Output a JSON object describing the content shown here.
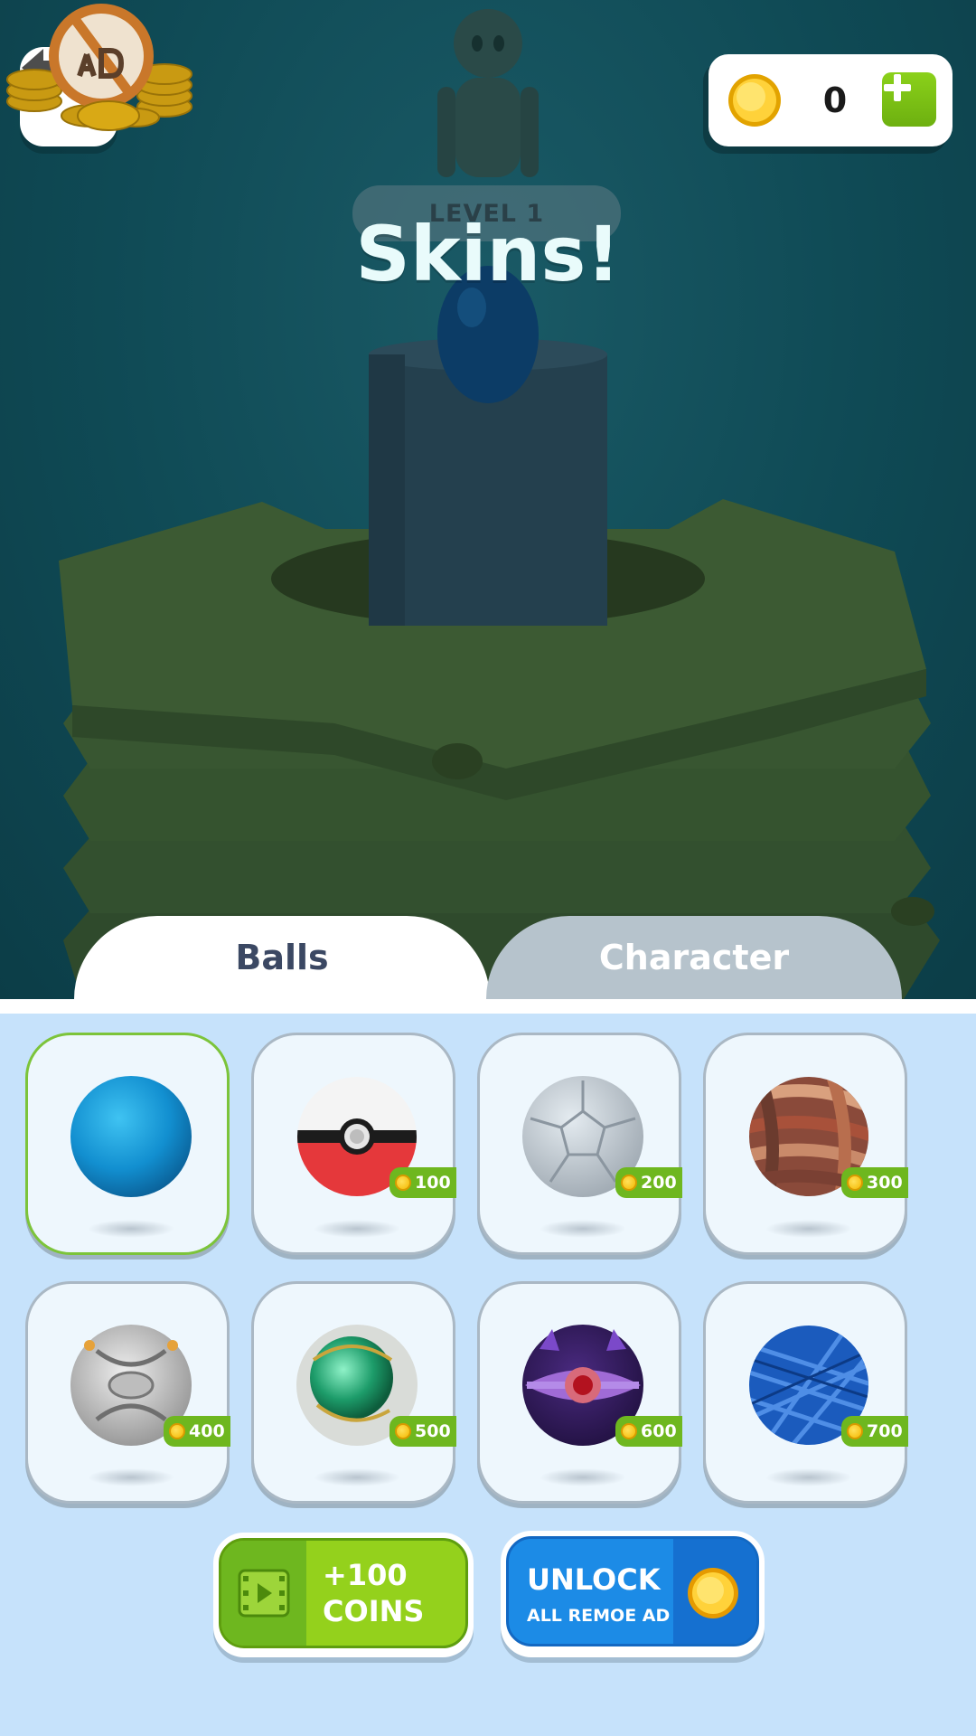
{
  "header": {
    "level_label": "LEVEL 1",
    "title": "Skins!",
    "coin_count": "0"
  },
  "icons": {
    "back": "back-arrow-icon",
    "coin": "coin-icon",
    "add": "plus-icon",
    "no_ads": "no-ads-icon",
    "video": "video-icon"
  },
  "tabs": [
    {
      "label": "Balls",
      "active": true
    },
    {
      "label": "Character",
      "active": false
    }
  ],
  "skins": [
    {
      "name": "blue-ball",
      "price": "",
      "selected": true
    },
    {
      "name": "pokeball",
      "price": "100",
      "selected": false
    },
    {
      "name": "silver-soccer-ball",
      "price": "200",
      "selected": false
    },
    {
      "name": "fabric-ball",
      "price": "300",
      "selected": false
    },
    {
      "name": "mech-ball",
      "price": "400",
      "selected": false
    },
    {
      "name": "green-orb-ball",
      "price": "500",
      "selected": false
    },
    {
      "name": "purple-eye-ball",
      "price": "600",
      "selected": false
    },
    {
      "name": "blue-yarn-ball",
      "price": "700",
      "selected": false
    }
  ],
  "buttons": {
    "coins": {
      "line1": "+100",
      "line2": "COINS"
    },
    "unlock": {
      "line1": "UNLOCK",
      "line2": "ALL REMOE AD"
    }
  },
  "colors": {
    "panel_bg": "#c6e2fb",
    "accent_green": "#6eb71f",
    "accent_blue": "#1c8be6",
    "coin_gold": "#f4b800"
  }
}
